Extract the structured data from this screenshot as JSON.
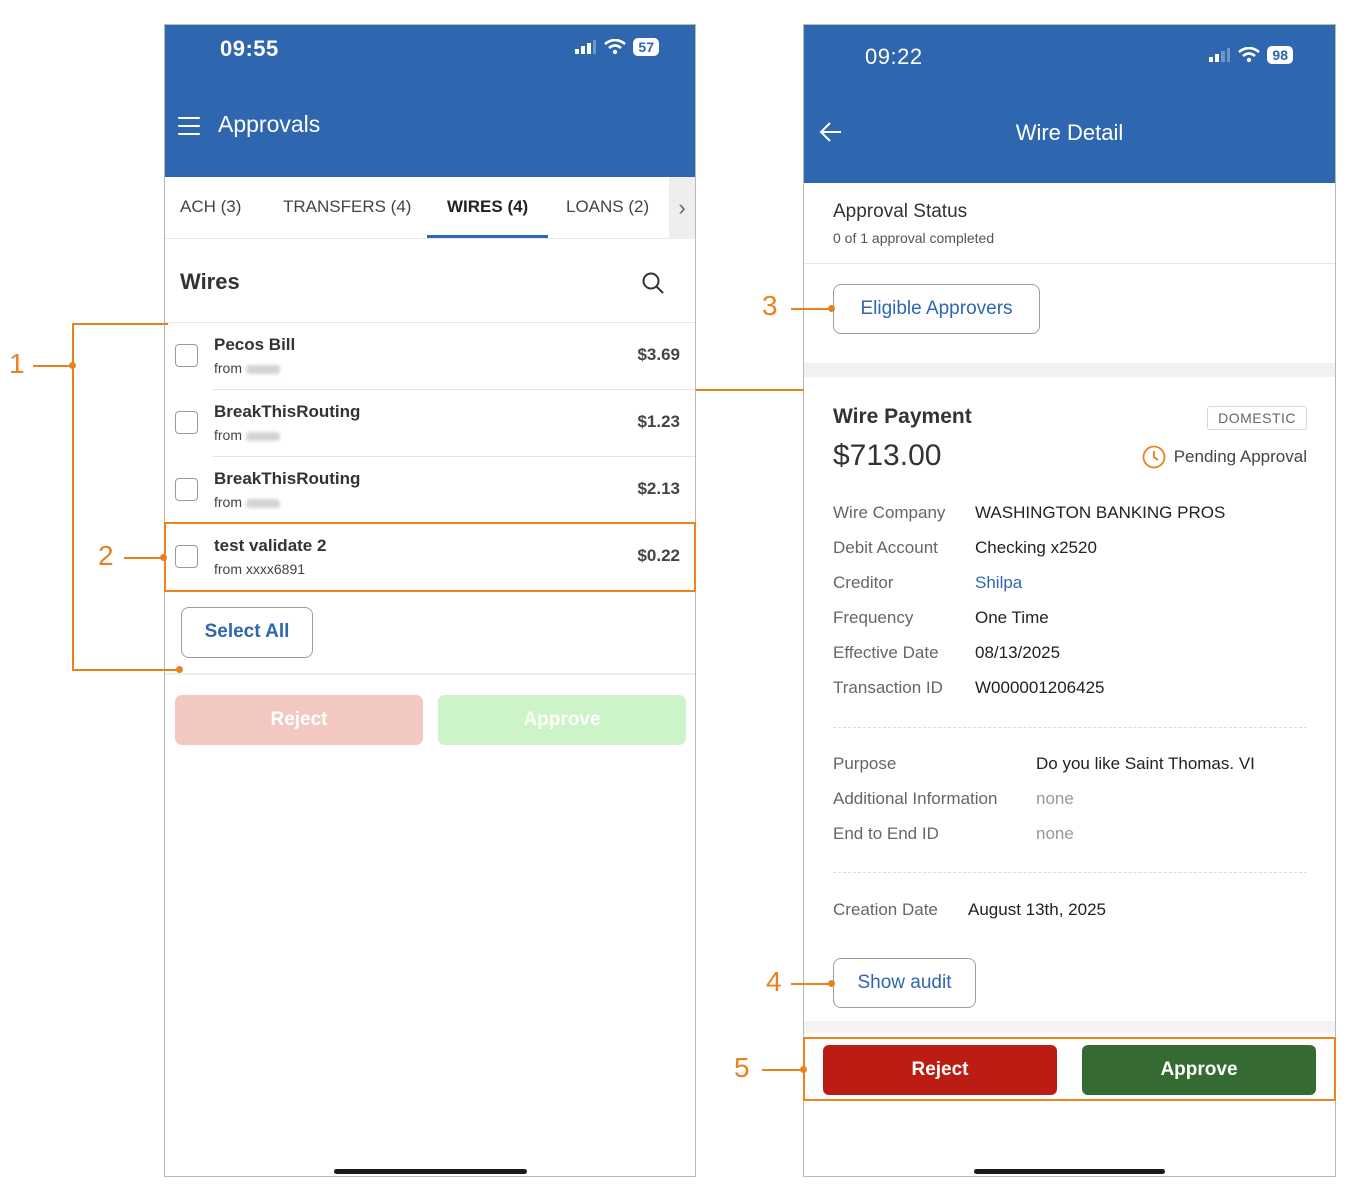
{
  "left_phone": {
    "status_time": "09:55",
    "battery": "57",
    "title": "Approvals",
    "tabs": [
      {
        "label": "ACH (3)"
      },
      {
        "label": "TRANSFERS (4)"
      },
      {
        "label": "WIRES (4)"
      },
      {
        "label": "LOANS (2)"
      }
    ],
    "active_tab": "WIRES (4)",
    "list_title": "Wires",
    "wires": [
      {
        "name": "Pecos Bill",
        "from": "from",
        "amount": "$3.69"
      },
      {
        "name": "BreakThisRouting",
        "from": "from",
        "amount": "$1.23"
      },
      {
        "name": "BreakThisRouting",
        "from": "from",
        "amount": "$2.13"
      },
      {
        "name": "test validate 2",
        "from": "from xxxx6891",
        "amount": "$0.22"
      }
    ],
    "select_all_label": "Select All",
    "reject_label": "Reject",
    "approve_label": "Approve"
  },
  "right_phone": {
    "status_time": "09:22",
    "battery": "98",
    "title": "Wire Detail",
    "approval_status_title": "Approval Status",
    "approval_status_sub": "0 of 1 approval completed",
    "eligible_approvers_label": "Eligible Approvers",
    "wire_type": "Wire Payment",
    "badge": "DOMESTIC",
    "amount": "$713.00",
    "status": "Pending Approval",
    "details": [
      {
        "label": "Wire Company",
        "value": "WASHINGTON BANKING PROS"
      },
      {
        "label": "Debit Account",
        "value": "Checking x2520"
      },
      {
        "label": "Creditor",
        "value": "Shilpa"
      },
      {
        "label": "Frequency",
        "value": "One Time"
      },
      {
        "label": "Effective Date",
        "value": "08/13/2025"
      },
      {
        "label": "Transaction ID",
        "value": "W000001206425"
      }
    ],
    "extra_details": [
      {
        "label": "Purpose",
        "value": "Do you like Saint Thomas. VI"
      },
      {
        "label": "Additional Information",
        "value": "none"
      },
      {
        "label": "End to End ID",
        "value": "none"
      }
    ],
    "creation_date_label": "Creation Date",
    "creation_date_value": "August 13th, 2025",
    "show_audit_label": "Show audit",
    "reject_label": "Reject",
    "approve_label": "Approve"
  },
  "callouts": [
    "1",
    "2",
    "3",
    "4",
    "5"
  ],
  "colors": {
    "header_blue": "#2f66b0",
    "reject_red": "#bb1d12",
    "approve_green": "#356b33",
    "callout_orange": "#e8821e"
  }
}
